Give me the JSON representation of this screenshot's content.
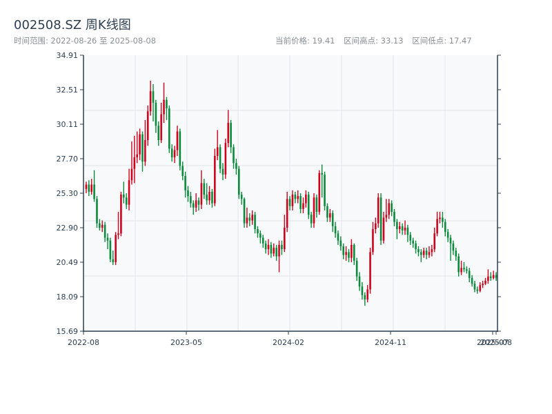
{
  "header": {
    "title": "002508.SZ 周K线图",
    "range_text": "时间范围: 2022-08-26 至 2025-08-08",
    "current_price": "当前价格: 19.41",
    "range_high": "区间高点: 33.13",
    "range_low": "区间低点: 17.47"
  },
  "colors": {
    "up": "#d0021b",
    "down": "#0a8a3a",
    "plot_bg": "#f7f9fb",
    "grid": "#e3e6ea",
    "axis": "#2c3e50"
  },
  "chart_data": {
    "type": "candlestick",
    "title": "002508.SZ 周K线图",
    "ylim": [
      15.69,
      34.91
    ],
    "y_ticks": [
      "15.69",
      "18.09",
      "20.49",
      "22.90",
      "25.30",
      "27.70",
      "30.11",
      "32.51",
      "34.91"
    ],
    "x_ticks": [
      "2022-08",
      "2023-05",
      "2024-02",
      "2024-11",
      "2025-07",
      "2025-08"
    ],
    "grid": true,
    "candle_fields": [
      "open",
      "close",
      "low",
      "high"
    ],
    "candles": [
      [
        25.6,
        25.9,
        25.3,
        26.1
      ],
      [
        25.9,
        25.4,
        25.1,
        26.2
      ],
      [
        25.4,
        25.9,
        25.2,
        26.3
      ],
      [
        25.9,
        24.9,
        24.7,
        26.9
      ],
      [
        24.9,
        23.2,
        22.9,
        25.1
      ],
      [
        23.2,
        22.9,
        22.7,
        23.5
      ],
      [
        22.9,
        23.1,
        22.6,
        23.4
      ],
      [
        23.1,
        22.2,
        21.9,
        23.3
      ],
      [
        22.2,
        22.0,
        21.4,
        22.5
      ],
      [
        22.0,
        20.7,
        20.5,
        22.2
      ],
      [
        20.7,
        20.5,
        20.3,
        21.3
      ],
      [
        20.5,
        22.4,
        20.3,
        22.6
      ],
      [
        22.4,
        22.5,
        22.1,
        24.0
      ],
      [
        22.5,
        25.2,
        22.3,
        25.4
      ],
      [
        25.2,
        25.0,
        24.6,
        26.1
      ],
      [
        25.0,
        24.5,
        24.2,
        25.3
      ],
      [
        24.5,
        26.2,
        24.1,
        27.0
      ],
      [
        26.2,
        27.0,
        25.9,
        28.9
      ],
      [
        27.0,
        27.8,
        26.0,
        29.3
      ],
      [
        27.8,
        28.0,
        27.4,
        29.6
      ],
      [
        28.0,
        29.4,
        27.6,
        29.8
      ],
      [
        29.4,
        27.5,
        26.8,
        29.6
      ],
      [
        27.5,
        29.0,
        27.2,
        30.4
      ],
      [
        29.0,
        31.0,
        28.6,
        31.4
      ],
      [
        31.0,
        32.4,
        30.7,
        33.13
      ],
      [
        32.4,
        31.6,
        30.3,
        32.9
      ],
      [
        31.6,
        30.0,
        29.5,
        31.8
      ],
      [
        30.0,
        29.0,
        28.6,
        30.3
      ],
      [
        29.0,
        30.8,
        28.8,
        31.6
      ],
      [
        30.8,
        31.8,
        30.2,
        33.0
      ],
      [
        31.8,
        31.2,
        30.4,
        32.0
      ],
      [
        31.2,
        28.4,
        28.1,
        31.4
      ],
      [
        28.4,
        27.8,
        27.5,
        28.7
      ],
      [
        27.8,
        28.3,
        27.4,
        28.6
      ],
      [
        28.3,
        29.6,
        27.9,
        30.0
      ],
      [
        29.6,
        27.2,
        26.9,
        29.8
      ],
      [
        27.2,
        26.5,
        26.2,
        27.5
      ],
      [
        26.5,
        25.5,
        25.0,
        26.8
      ],
      [
        25.5,
        25.1,
        24.7,
        25.8
      ],
      [
        25.1,
        24.6,
        24.3,
        25.4
      ],
      [
        24.6,
        24.3,
        23.8,
        24.8
      ],
      [
        24.3,
        24.8,
        24.0,
        25.3
      ],
      [
        24.8,
        24.5,
        24.1,
        25.0
      ],
      [
        24.5,
        26.0,
        24.2,
        26.9
      ],
      [
        26.0,
        25.2,
        24.9,
        26.3
      ],
      [
        25.2,
        24.8,
        24.5,
        26.0
      ],
      [
        24.8,
        25.4,
        24.5,
        25.8
      ],
      [
        25.4,
        24.6,
        24.3,
        25.6
      ],
      [
        24.6,
        27.9,
        24.4,
        28.4
      ],
      [
        27.9,
        28.5,
        27.6,
        29.7
      ],
      [
        28.5,
        27.0,
        26.7,
        28.7
      ],
      [
        27.0,
        26.6,
        26.2,
        27.4
      ],
      [
        26.6,
        28.8,
        26.3,
        29.1
      ],
      [
        28.8,
        30.2,
        28.5,
        31.1
      ],
      [
        30.2,
        28.5,
        28.1,
        30.4
      ],
      [
        28.5,
        27.4,
        27.0,
        28.7
      ],
      [
        27.4,
        27.0,
        26.6,
        27.7
      ],
      [
        27.0,
        25.2,
        24.9,
        27.2
      ],
      [
        25.2,
        24.9,
        24.5,
        25.4
      ],
      [
        24.9,
        23.2,
        22.9,
        25.0
      ],
      [
        23.2,
        23.6,
        22.9,
        24.3
      ],
      [
        23.6,
        23.4,
        23.0,
        23.9
      ],
      [
        23.4,
        23.8,
        23.1,
        24.1
      ],
      [
        23.8,
        22.8,
        22.5,
        24.0
      ],
      [
        22.8,
        22.5,
        22.2,
        23.0
      ],
      [
        22.5,
        22.2,
        21.8,
        22.7
      ],
      [
        22.2,
        21.8,
        21.5,
        22.4
      ],
      [
        21.8,
        21.4,
        21.1,
        22.0
      ],
      [
        21.4,
        21.7,
        21.0,
        22.1
      ],
      [
        21.7,
        21.1,
        20.8,
        21.9
      ],
      [
        21.1,
        21.5,
        20.9,
        21.8
      ],
      [
        21.5,
        20.9,
        20.6,
        21.7
      ],
      [
        20.9,
        21.7,
        19.8,
        22.0
      ],
      [
        21.7,
        21.4,
        21.0,
        22.0
      ],
      [
        21.4,
        22.9,
        21.2,
        23.8
      ],
      [
        22.9,
        24.9,
        22.6,
        25.4
      ],
      [
        24.9,
        24.4,
        24.1,
        25.1
      ],
      [
        24.4,
        25.2,
        24.1,
        25.5
      ],
      [
        25.2,
        24.9,
        24.6,
        25.4
      ],
      [
        24.9,
        25.1,
        24.6,
        25.5
      ],
      [
        25.1,
        24.2,
        23.9,
        25.3
      ],
      [
        24.2,
        24.6,
        23.9,
        25.0
      ],
      [
        24.6,
        25.2,
        24.3,
        25.5
      ],
      [
        25.2,
        23.8,
        23.5,
        25.4
      ],
      [
        23.8,
        23.2,
        22.9,
        24.0
      ],
      [
        23.2,
        25.0,
        22.9,
        25.3
      ],
      [
        25.0,
        24.0,
        23.6,
        25.2
      ],
      [
        24.0,
        26.7,
        23.8,
        26.9
      ],
      [
        26.7,
        26.6,
        25.0,
        27.3
      ],
      [
        26.6,
        24.4,
        24.1,
        26.8
      ],
      [
        24.4,
        23.6,
        23.3,
        24.6
      ],
      [
        23.6,
        23.9,
        23.3,
        24.2
      ],
      [
        23.9,
        23.0,
        22.6,
        24.1
      ],
      [
        23.0,
        22.5,
        22.2,
        23.3
      ],
      [
        22.5,
        22.0,
        21.7,
        22.7
      ],
      [
        22.0,
        21.6,
        21.3,
        22.3
      ],
      [
        21.6,
        21.0,
        20.7,
        21.8
      ],
      [
        21.0,
        21.2,
        20.6,
        21.6
      ],
      [
        21.2,
        20.8,
        20.5,
        21.4
      ],
      [
        20.8,
        21.7,
        20.5,
        22.1
      ],
      [
        21.7,
        20.6,
        20.3,
        21.8
      ],
      [
        20.6,
        19.5,
        19.2,
        20.8
      ],
      [
        19.5,
        18.8,
        18.5,
        19.8
      ],
      [
        18.8,
        18.2,
        17.9,
        19.1
      ],
      [
        18.2,
        17.9,
        17.47,
        18.4
      ],
      [
        17.9,
        18.6,
        17.7,
        18.9
      ],
      [
        18.6,
        21.2,
        18.3,
        21.5
      ],
      [
        21.2,
        22.8,
        21.0,
        23.3
      ],
      [
        22.8,
        23.2,
        22.5,
        23.6
      ],
      [
        23.2,
        25.0,
        22.9,
        25.3
      ],
      [
        25.0,
        22.0,
        21.7,
        25.3
      ],
      [
        22.0,
        23.6,
        21.8,
        24.0
      ],
      [
        23.6,
        23.8,
        23.3,
        24.9
      ],
      [
        23.8,
        24.6,
        23.5,
        24.9
      ],
      [
        24.6,
        24.0,
        23.7,
        24.8
      ],
      [
        24.0,
        23.3,
        23.0,
        24.2
      ],
      [
        23.3,
        22.8,
        22.1,
        23.5
      ],
      [
        22.8,
        23.0,
        22.5,
        23.3
      ],
      [
        23.0,
        22.7,
        22.4,
        23.2
      ],
      [
        22.7,
        22.9,
        22.4,
        23.4
      ],
      [
        22.9,
        22.4,
        21.9,
        23.1
      ],
      [
        22.4,
        22.0,
        21.7,
        22.6
      ],
      [
        22.0,
        21.8,
        21.5,
        22.2
      ],
      [
        21.8,
        21.4,
        21.1,
        22.0
      ],
      [
        21.4,
        21.2,
        20.9,
        21.6
      ],
      [
        21.2,
        21.0,
        20.5,
        21.4
      ],
      [
        21.0,
        21.3,
        20.8,
        21.5
      ],
      [
        21.3,
        21.0,
        20.7,
        21.5
      ],
      [
        21.0,
        21.2,
        20.8,
        21.6
      ],
      [
        21.2,
        21.4,
        20.9,
        21.7
      ],
      [
        21.4,
        22.5,
        21.2,
        22.9
      ],
      [
        22.5,
        23.5,
        22.3,
        24.0
      ],
      [
        23.5,
        23.6,
        23.2,
        24.0
      ],
      [
        23.6,
        23.3,
        22.9,
        24.0
      ],
      [
        23.3,
        22.6,
        22.3,
        23.5
      ],
      [
        22.6,
        22.2,
        21.9,
        22.8
      ],
      [
        22.2,
        21.8,
        20.6,
        22.4
      ],
      [
        21.8,
        21.3,
        21.0,
        22.0
      ],
      [
        21.3,
        20.9,
        20.6,
        21.5
      ],
      [
        20.9,
        19.8,
        19.5,
        21.1
      ],
      [
        19.8,
        20.1,
        19.6,
        20.6
      ],
      [
        20.1,
        20.0,
        19.8,
        20.5
      ],
      [
        20.0,
        19.9,
        19.7,
        20.2
      ],
      [
        19.9,
        19.4,
        19.1,
        20.1
      ],
      [
        19.4,
        19.0,
        18.8,
        19.6
      ],
      [
        19.0,
        18.6,
        18.4,
        19.2
      ],
      [
        18.6,
        18.5,
        18.3,
        18.8
      ],
      [
        18.5,
        18.9,
        18.4,
        19.1
      ],
      [
        18.9,
        19.0,
        18.7,
        19.2
      ],
      [
        19.0,
        19.2,
        18.9,
        19.4
      ],
      [
        19.2,
        19.5,
        19.0,
        20.0
      ],
      [
        19.5,
        19.4,
        19.2,
        19.8
      ],
      [
        19.4,
        19.6,
        19.3,
        19.9
      ],
      [
        19.6,
        19.41,
        19.2,
        19.8
      ]
    ]
  }
}
